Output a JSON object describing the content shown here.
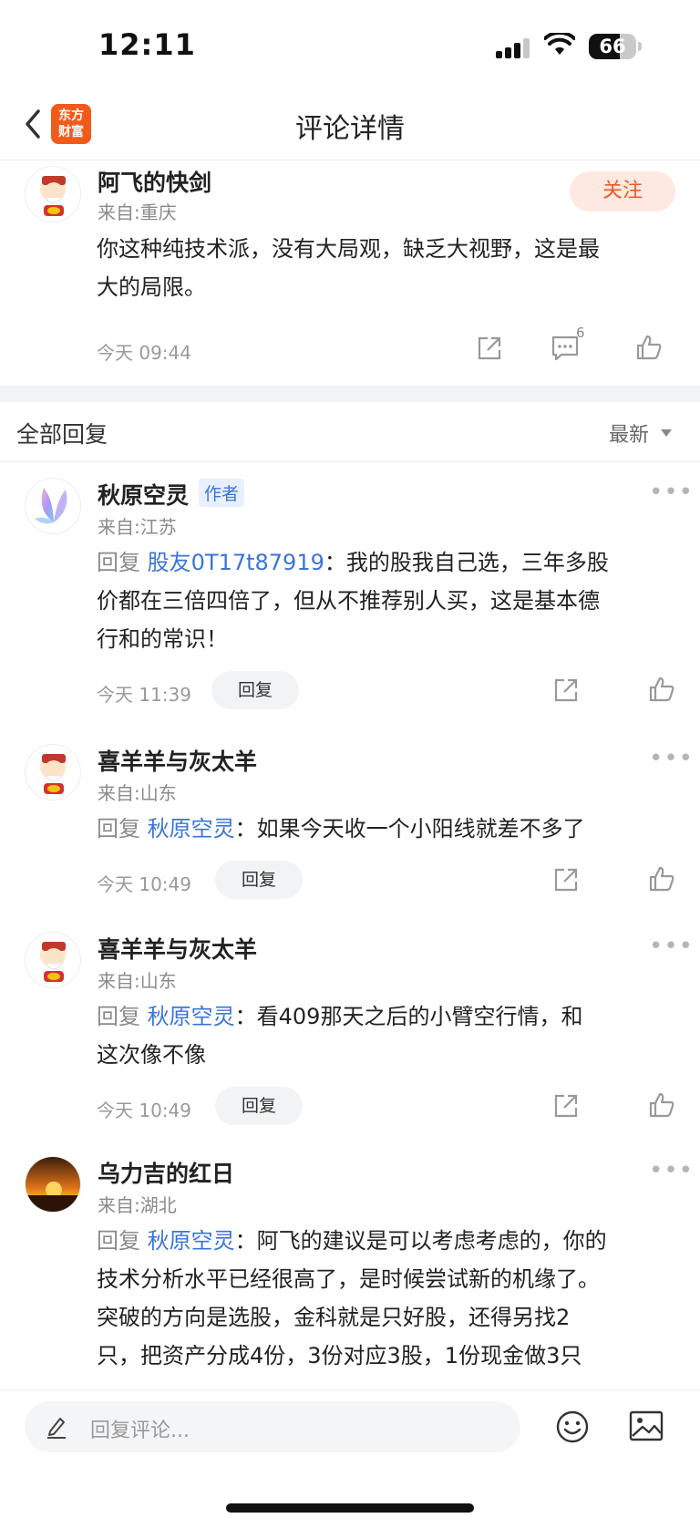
{
  "status_bar": {
    "time": "12:11",
    "battery": "66",
    "battery_level_percent": 66
  },
  "nav": {
    "title": "评论详情",
    "logo_text": "东方财富"
  },
  "main_comment": {
    "username": "阿飞的快剑",
    "location": "来自:重庆",
    "follow_label": "关注",
    "content_line1": "你这种纯技术派，没有大局观，缺乏大视野，这是最",
    "content_line2": "大的局限。",
    "time": "今天 09:44",
    "comment_count": "6"
  },
  "replies_header": {
    "title": "全部回复",
    "sort_label": "最新"
  },
  "reply_prefix": "回复",
  "reply_button_label": "回复",
  "replies": [
    {
      "username": "秋原空灵",
      "tag": "作者",
      "location": "来自:江苏",
      "target": "股友0T17t87919",
      "lines": [
        "：我的股我自己选，三年多股",
        "价都在三倍四倍了，但从不推荐别人买，这是基本德",
        "行和的常识！"
      ],
      "time": "今天 11:39"
    },
    {
      "username": "喜羊羊与灰太羊",
      "location": "来自:山东",
      "target": "秋原空灵",
      "lines": [
        "：如果今天收一个小阳线就差不多了"
      ],
      "time": "今天 10:49"
    },
    {
      "username": "喜羊羊与灰太羊",
      "location": "来自:山东",
      "target": "秋原空灵",
      "lines": [
        "：看409那天之后的小臂空行情，和",
        "这次像不像"
      ],
      "time": "今天 10:49"
    },
    {
      "username": "乌力吉的红日",
      "location": "来自:湖北",
      "target": "秋原空灵",
      "lines": [
        "：阿飞的建议是可以考虑考虑的，你的",
        "技术分析水平已经很高了，是时候尝试新的机缘了。",
        "突破的方向是选股，金科就是只好股，还得另找2",
        "只，把资产分成4份，3份对应3股，1份现金做3只"
      ]
    }
  ],
  "input": {
    "placeholder": "回复评论..."
  },
  "colors": {
    "accent": "#ee5a24",
    "link": "#3b74d8",
    "muted": "#8a8a8a"
  }
}
